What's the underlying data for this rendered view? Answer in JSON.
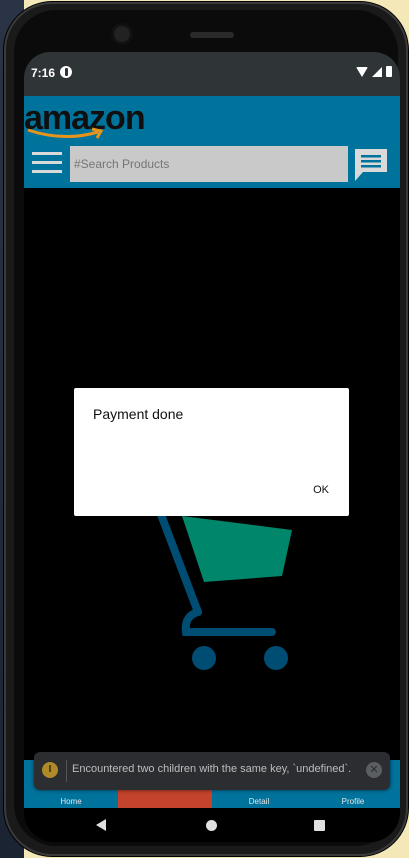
{
  "status_bar": {
    "time": "7:16"
  },
  "header": {
    "logo_text": "amazon",
    "search": {
      "placeholder": "#Search Products",
      "value": ""
    }
  },
  "dialog": {
    "title": "Payment done",
    "ok_label": "OK"
  },
  "tabs": [
    {
      "label": "Home",
      "active": false
    },
    {
      "label": "",
      "active": true
    },
    {
      "label": "Detail",
      "active": false
    },
    {
      "label": "Profile",
      "active": false
    }
  ],
  "toast": {
    "message": "Encountered two children with the same key, `undefined`. ..."
  },
  "colors": {
    "appbar": "#00739d",
    "active_tab": "#c4432c",
    "cart_basket": "#00876b",
    "cart_frame": "#004d73"
  },
  "icons": [
    "menu-icon",
    "chat-icon",
    "cart-icon",
    "warning-icon",
    "close-icon",
    "back-icon",
    "home-icon",
    "recents-icon"
  ]
}
